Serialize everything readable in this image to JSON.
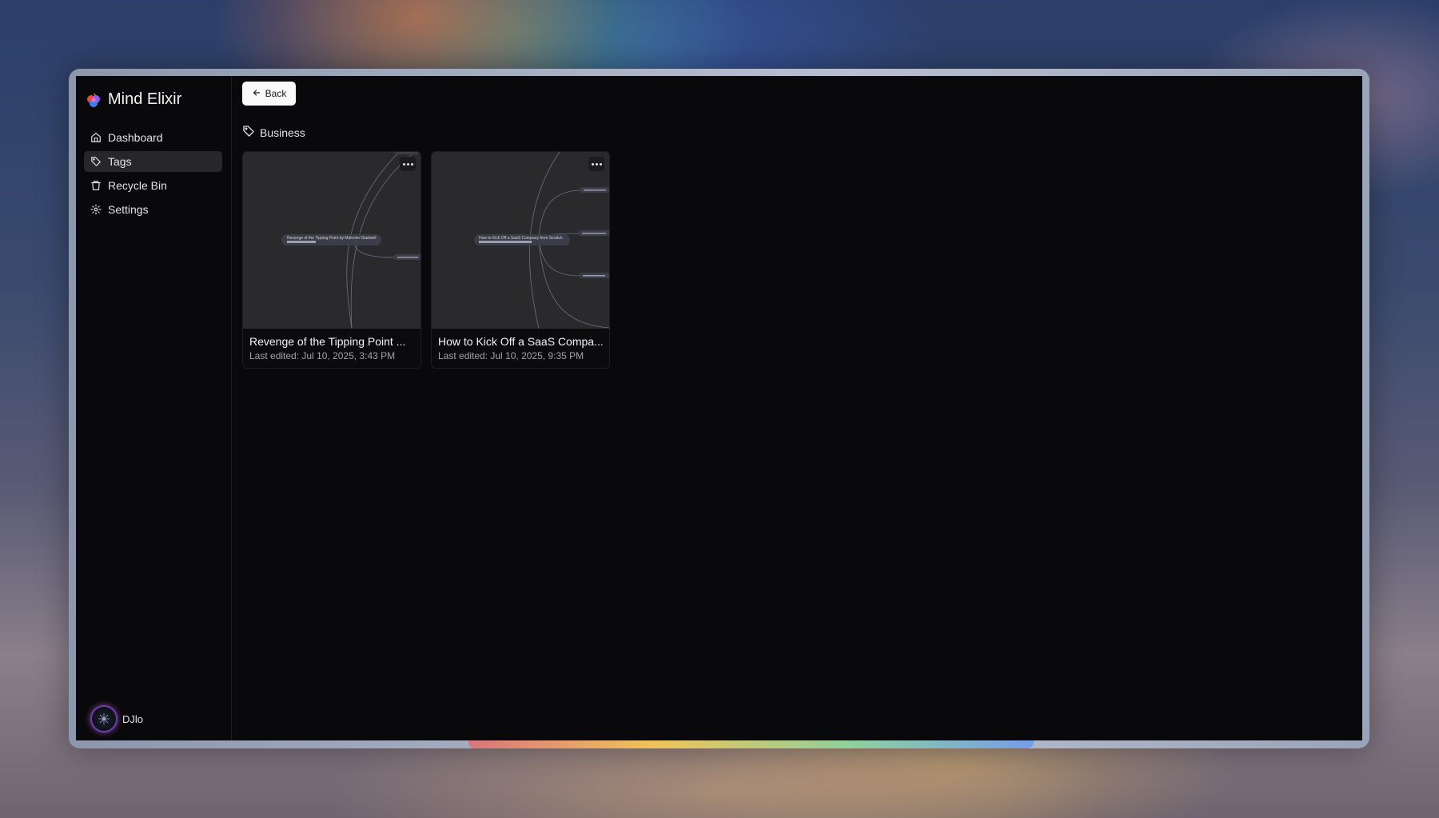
{
  "brand": {
    "title": "Mind Elixir",
    "icon": "mind-elixir-logo-icon"
  },
  "nav": [
    {
      "label": "Dashboard",
      "icon": "home-icon",
      "active": false
    },
    {
      "label": "Tags",
      "icon": "tag-icon",
      "active": true
    },
    {
      "label": "Recycle Bin",
      "icon": "trash-icon",
      "active": false
    },
    {
      "label": "Settings",
      "icon": "gear-icon",
      "active": false
    }
  ],
  "user": {
    "name": "DJlo",
    "icon": "avatar-icon"
  },
  "toolbar": {
    "back_label": "Back",
    "back_icon": "arrow-left-icon"
  },
  "tag": {
    "name": "Business",
    "icon": "tag-icon"
  },
  "cards": [
    {
      "title": "Revenge of the Tipping Point ...",
      "date": "Last edited: Jul 10, 2025, 3:43 PM",
      "root_text": "Revenge of the Tipping Point by Malcolm Gladwell"
    },
    {
      "title": "How to Kick Off a SaaS Compa...",
      "date": "Last edited: Jul 10, 2025, 9:35 PM",
      "root_text": "How to Kick Off a SaaS Company from Scratch"
    }
  ],
  "colors": {
    "app_bg": "#09090b",
    "card_thumb_bg": "#2a2a2d",
    "active_nav_bg": "#27272a",
    "button_bg": "#fafafa"
  }
}
